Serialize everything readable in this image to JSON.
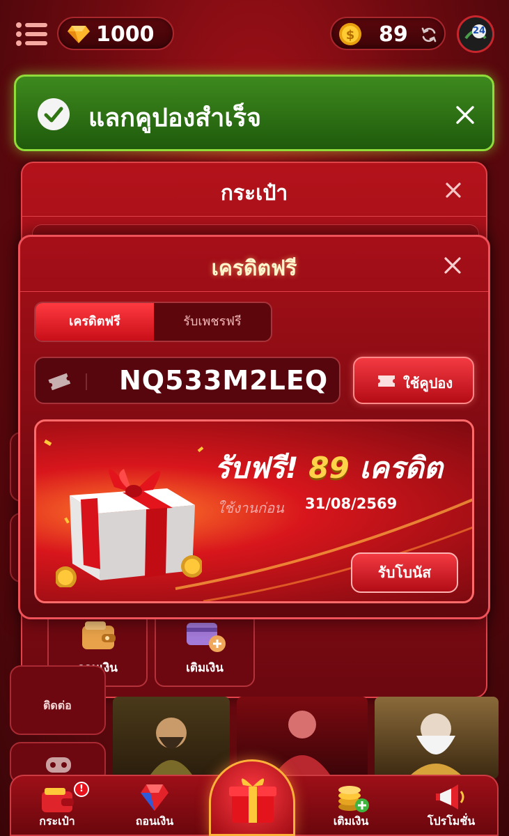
{
  "header": {
    "gem_balance": "1000",
    "coin_balance": "89",
    "avatar_badge": "24"
  },
  "toast": {
    "message": "แลกคูปองสำเร็จ"
  },
  "wallet_modal": {
    "title": "กระเป๋า",
    "tiles": [
      {
        "label": "ถอนเงิน"
      },
      {
        "label": "เติมเงิน"
      }
    ]
  },
  "side_menu": {
    "contact_label": "ติดต่อ"
  },
  "credit_modal": {
    "title": "เครดิตฟรี",
    "tabs": [
      {
        "label": "เครดิตฟรี",
        "active": true
      },
      {
        "label": "รับเพชรฟรี",
        "active": false
      }
    ],
    "coupon_code": "NQ533M2LEQ",
    "use_button": "ใช้คูปอง",
    "banner": {
      "title_prefix": "รับฟรี!",
      "amount": "89",
      "unit": "เครดิต",
      "expiry_label": "ใช้งานก่อน",
      "expiry_date": "31/08/2569",
      "claim_button": "รับโบนัส"
    }
  },
  "bottom_nav": {
    "items": [
      {
        "label": "กระเป๋า",
        "badge": "!"
      },
      {
        "label": "ถอนเงิน"
      },
      {
        "label": "เติมเงิน"
      },
      {
        "label": "โปรโมชั่น"
      }
    ]
  },
  "colors": {
    "background": "#8e0c14",
    "accent_red": "#e52a33",
    "gold": "#ffc83a",
    "toast_green": "#2f7514",
    "toast_border": "#8fdc3b"
  }
}
